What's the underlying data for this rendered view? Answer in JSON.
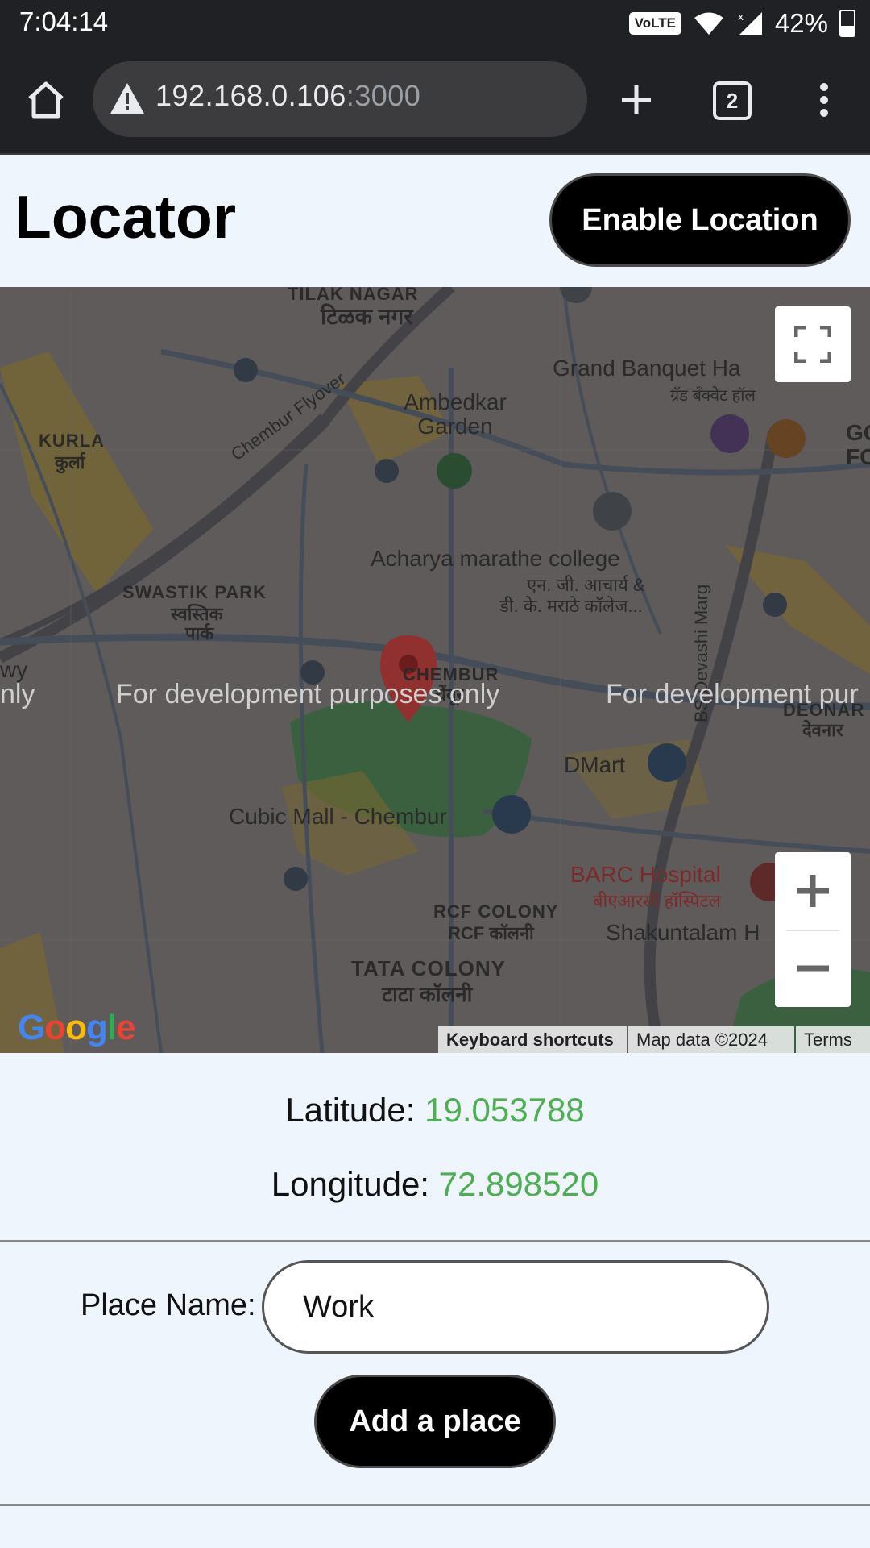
{
  "status_bar": {
    "time": "7:04:14",
    "volte": "VoLTE",
    "battery": "42%"
  },
  "browser": {
    "url_host": "192.168.0.106",
    "url_port": ":3000",
    "tab_count": "2",
    "icons": [
      "home-icon",
      "warning-icon",
      "add-tab-icon",
      "tab-switcher-icon",
      "menu-icon"
    ]
  },
  "app": {
    "title": "Locator",
    "enable_location_label": "Enable Location"
  },
  "map": {
    "labels": {
      "tilak_nagar": "TILAK NAGAR",
      "tilak_nagar_hi": "टिळक नगर",
      "grand_banquet": "Grand Banquet Ha",
      "grand_banquet_hi": "ग्रँड बँक्वेट हॉल",
      "kurla": "KURLA",
      "kurla_hi": "कुर्ला",
      "ambedkar_garden": "Ambedkar\nGarden",
      "chembur_flyover": "Chembur Flyover",
      "goo": "GOO",
      "foo": "FOO",
      "acharya": "Acharya marathe college",
      "acharya_hi1": "एन. जी. आचार्य &",
      "acharya_hi2": "डी. के. मराठे कॉलेज...",
      "swastik_park": "SWASTIK PARK",
      "swastik_hi1": "स्वस्तिक",
      "swastik_hi2": "पार्क",
      "chembur": "CHEMBUR",
      "chembur_hi": "चेंबूर",
      "wy": "wy",
      "dmart": "DMart",
      "bs_devashi": "BS Devashi Marg",
      "deonar": "DEONAR",
      "deonar_hi": "देवनार",
      "cubic_mall": "Cubic Mall - Chembur",
      "barc": "BARC Hospital",
      "barc_hi": "बीएआरसी हॉस्पिटल",
      "shakuntalam": "Shakuntalam H",
      "rcf_colony": "RCF COLONY",
      "rcf_colony_hi": "RCF कॉलनी",
      "tata_colony": "TATA COLONY",
      "tata_colony_hi": "टाटा कॉलनी"
    },
    "watermark": "For development purposes only",
    "watermark_left": "nly",
    "watermark_right": "For development pur",
    "google": "Google",
    "keyboard_shortcuts": "Keyboard shortcuts",
    "map_data": "Map data ©2024",
    "terms": "Terms",
    "zoom_in": "+",
    "zoom_out": "−"
  },
  "coords": {
    "latitude_label": "Latitude: ",
    "latitude_value": "19.053788",
    "longitude_label": "Longitude: ",
    "longitude_value": "72.898520"
  },
  "form": {
    "place_name_label": "Place Name:",
    "place_name_value": "Work",
    "add_place_label": "Add a place"
  },
  "colors": {
    "value_green": "#4caf50",
    "button_black": "#000000",
    "page_bg": "#eef5fd"
  }
}
